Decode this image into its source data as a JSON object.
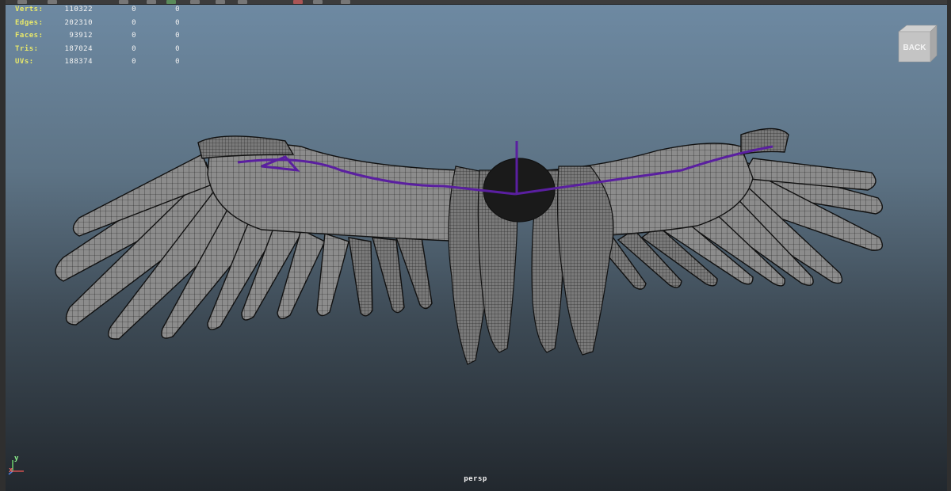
{
  "hud": {
    "rows": [
      {
        "label": "Verts:",
        "v1": "110322",
        "v2": "0",
        "v3": "0"
      },
      {
        "label": "Edges:",
        "v1": "202310",
        "v2": "0",
        "v3": "0"
      },
      {
        "label": "Faces:",
        "v1": "93912",
        "v2": "0",
        "v3": "0"
      },
      {
        "label": "Tris:",
        "v1": "187024",
        "v2": "0",
        "v3": "0"
      },
      {
        "label": "UVs:",
        "v1": "188374",
        "v2": "0",
        "v3": "0"
      }
    ]
  },
  "viewcube": {
    "face_label": "BACK"
  },
  "camera": {
    "label": "persp"
  },
  "axis": {
    "y": "y",
    "x": "x"
  },
  "colors": {
    "hud_label": "#e8e86a",
    "wire": "#111111",
    "mesh_fill": "#8a8a8a",
    "skeleton": "#5a1fa0"
  }
}
